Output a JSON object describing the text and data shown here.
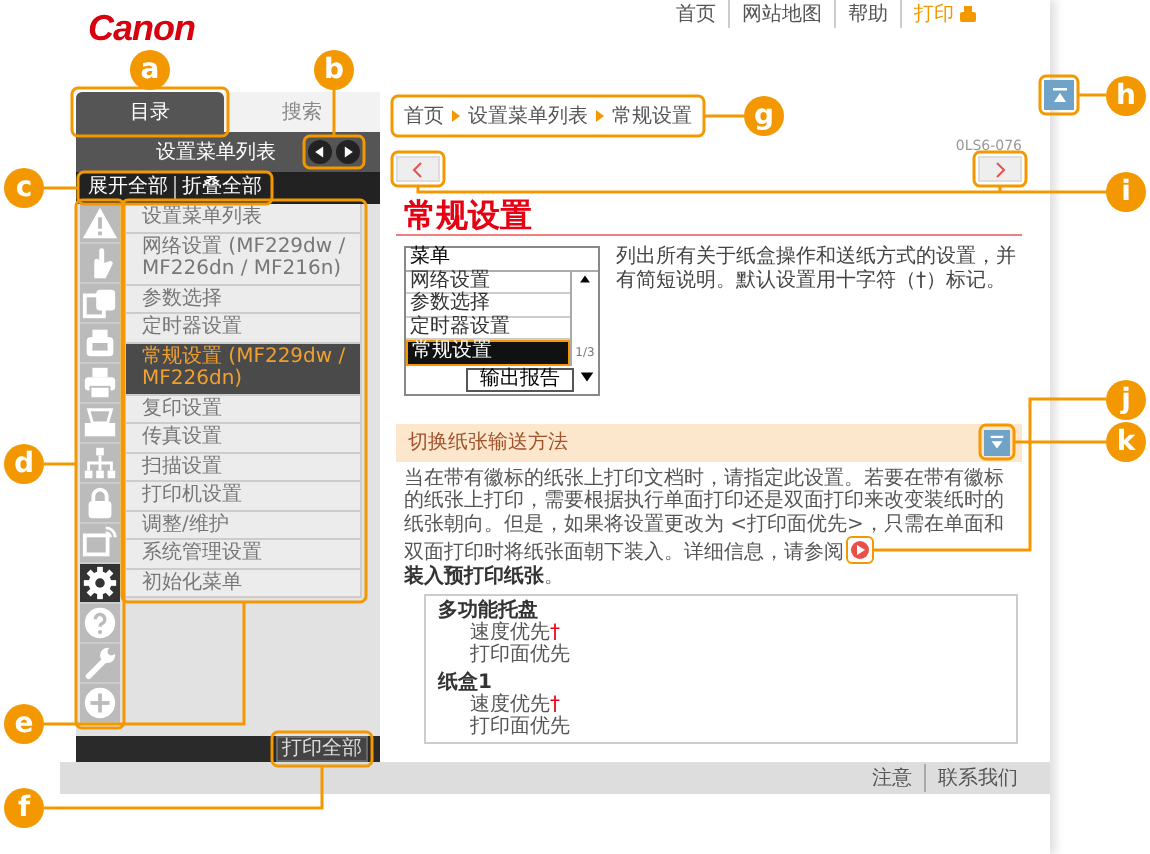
{
  "header": {
    "logo": "Canon",
    "links": [
      {
        "label": "首页",
        "kind": "plain"
      },
      {
        "label": "网站地图",
        "kind": "plain"
      },
      {
        "label": "帮助",
        "kind": "plain"
      },
      {
        "label": "打印",
        "kind": "print"
      }
    ]
  },
  "sidebar": {
    "tabs": [
      {
        "label": "目录",
        "selected": true
      },
      {
        "label": "搜索",
        "selected": false
      }
    ],
    "title": "设置菜单列表",
    "expand_all": "展开全部",
    "collapse_all": "折叠全部",
    "categories": [
      {
        "kind": "warning",
        "selected": false
      },
      {
        "kind": "hand",
        "selected": false
      },
      {
        "kind": "copy",
        "selected": false
      },
      {
        "kind": "fax",
        "selected": false
      },
      {
        "kind": "printer",
        "selected": false
      },
      {
        "kind": "scanner",
        "selected": false
      },
      {
        "kind": "network",
        "selected": false
      },
      {
        "kind": "lock",
        "selected": false
      },
      {
        "kind": "monitor",
        "selected": false
      },
      {
        "kind": "gear",
        "selected": true
      },
      {
        "kind": "help",
        "selected": false
      },
      {
        "kind": "wrench",
        "selected": false
      },
      {
        "kind": "plus",
        "selected": false
      }
    ],
    "menu_items": [
      {
        "label": "设置菜单列表",
        "selected": false
      },
      {
        "label": "网络设置 (MF229dw / MF226dn / MF216n)",
        "selected": false
      },
      {
        "label": "参数选择",
        "selected": false
      },
      {
        "label": "定时器设置",
        "selected": false
      },
      {
        "label": "常规设置 (MF229dw / MF226dn)",
        "selected": true
      },
      {
        "label": "复印设置",
        "selected": false
      },
      {
        "label": "传真设置",
        "selected": false
      },
      {
        "label": "扫描设置",
        "selected": false
      },
      {
        "label": "打印机设置",
        "selected": false
      },
      {
        "label": "调整/维护",
        "selected": false
      },
      {
        "label": "系统管理设置",
        "selected": false
      },
      {
        "label": "初始化菜单",
        "selected": false
      }
    ],
    "print_all": "打印全部"
  },
  "content": {
    "breadcrumb": [
      "首页",
      "设置菜单列表",
      "常规设置"
    ],
    "doc_id": "0LS6-076",
    "title": "常规设置",
    "screen": {
      "title": "菜单",
      "items": [
        {
          "label": "网络设置",
          "selected": false
        },
        {
          "label": "参数选择",
          "selected": false
        },
        {
          "label": "定时器设置",
          "selected": false
        },
        {
          "label": "常规设置",
          "selected": true
        }
      ],
      "button": "输出报告",
      "page": "1/3"
    },
    "intro": "列出所有关于纸盒操作和送纸方式的设置，并有简短说明。默认设置用十字符（†）标记。",
    "section": {
      "title": "切换纸张输送方法",
      "text": "当在带有徽标的纸张上打印文档时，请指定此设置。若要在带有徽标的纸张上打印，需要根据执行单面打印还是双面打印来改变装纸时的纸张朝向。但是，如果将设置更改为 <打印面优先>，只需在单面和双面打印时将纸张面朝下装入。详细信息，请参阅",
      "link": "装入预打印纸张",
      "tail": "。",
      "options": [
        {
          "group": "多功能托盘",
          "items": [
            {
              "label": "速度优先",
              "mark": "†"
            },
            {
              "label": "打印面优先"
            }
          ]
        },
        {
          "group": "纸盒1",
          "items": [
            {
              "label": "速度优先",
              "mark": "†"
            },
            {
              "label": "打印面优先"
            }
          ]
        }
      ]
    }
  },
  "footer": {
    "links": [
      "注意",
      "联系我们"
    ]
  },
  "callouts": [
    {
      "letter": "a"
    },
    {
      "letter": "b"
    },
    {
      "letter": "c"
    },
    {
      "letter": "d"
    },
    {
      "letter": "e"
    },
    {
      "letter": "f"
    },
    {
      "letter": "g"
    },
    {
      "letter": "h"
    },
    {
      "letter": "i"
    },
    {
      "letter": "j"
    },
    {
      "letter": "k"
    }
  ]
}
